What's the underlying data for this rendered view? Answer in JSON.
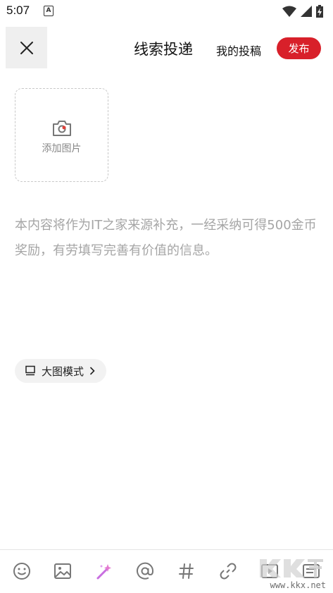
{
  "status": {
    "time": "5:07",
    "notif_icon": "A"
  },
  "header": {
    "title": "线索投递",
    "my_posts": "我的投稿",
    "publish": "发布"
  },
  "add_image": {
    "label": "添加图片"
  },
  "editor": {
    "placeholder": "本内容将作为IT之家来源补充，一经采纳可得500金币奖励，有劳填写完善有价值的信息。"
  },
  "big_mode": {
    "label": "大图模式"
  },
  "toolbar": {
    "items": [
      "emoji-icon",
      "image-icon",
      "magic-wand-icon",
      "at-icon",
      "hashtag-icon",
      "link-icon",
      "video-icon",
      "card-icon"
    ]
  },
  "watermark": {
    "url": "www.kkx.net"
  },
  "colors": {
    "accent": "#d8202a"
  }
}
